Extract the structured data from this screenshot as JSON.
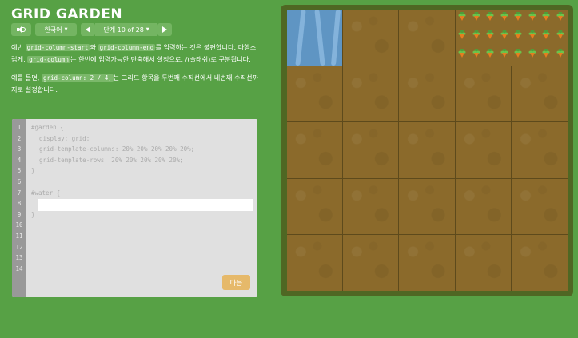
{
  "app": {
    "title": "GRID GARDEN"
  },
  "toolbar": {
    "sound_icon": "speaker-icon",
    "language_label": "한국어",
    "prev_icon": "arrow-left-icon",
    "level_label": "단계 10 of 28",
    "next_icon": "arrow-right-icon"
  },
  "instructions": {
    "p1_prefix": "예번 ",
    "p1_code1": "grid-column-start",
    "p1_mid1": "와 ",
    "p1_code2": "grid-column-end",
    "p1_mid2": "를 입력하는 것은 불편합니다. 다행스럽게, ",
    "p1_code3": "grid-column",
    "p1_suffix": "는 한번에 입력가능한 단축해서 설정으로, /(슬래쉬)로 구분됩니다.",
    "p2_prefix": "예를 들면, ",
    "p2_code": "grid-column: 2 / 4;",
    "p2_suffix": "는 그리드 항목을 두번째 수직선에서 네번째 수직선까지로 설정합니다."
  },
  "editor": {
    "line_numbers": [
      "1",
      "2",
      "3",
      "4",
      "5",
      "6",
      "7",
      "8",
      "9",
      "10",
      "11",
      "12",
      "13",
      "14"
    ],
    "lines": {
      "l1": "#garden {",
      "l2": "display: grid;",
      "l3": "grid-template-columns: 20% 20% 20% 20% 20%;",
      "l4": "grid-template-rows: 20% 20% 20% 20% 20%;",
      "l5": "}",
      "l6": "",
      "l7": "#water {",
      "l9": "}"
    },
    "input_value": "",
    "next_label": "다음"
  },
  "colors": {
    "background": "#57a145",
    "board_frame": "#4f6723",
    "soil": "#8b6a2b",
    "water": "#5f95c3",
    "next_button": "#e6b96a"
  }
}
